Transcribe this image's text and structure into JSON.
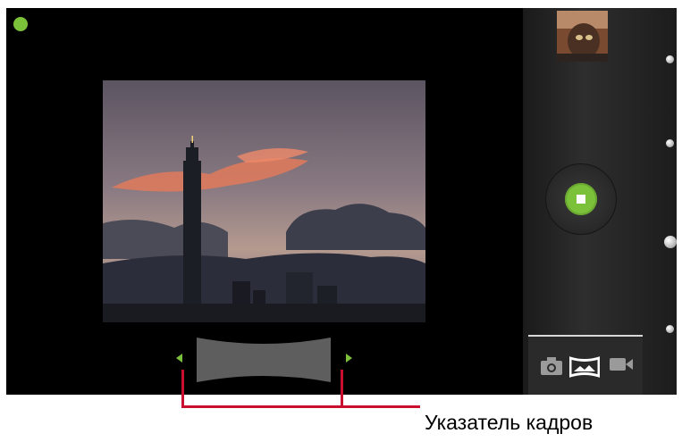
{
  "camera": {
    "status_color": "#7cc13a",
    "accent_color": "#7cc13a",
    "status_indicator": "recording-status-dot",
    "viewfinder_content": "city-skyline-at-dusk",
    "frame_indicator": {
      "left_arrow": "arrow-left-icon",
      "right_arrow": "arrow-right-icon"
    },
    "side_panel": {
      "thumbnail": "last-photo-thumbnail",
      "shutter_icon": "stop-icon",
      "modes": [
        {
          "name": "photo",
          "icon": "camera-icon",
          "active": false
        },
        {
          "name": "panorama",
          "icon": "panorama-icon",
          "active": true
        },
        {
          "name": "video",
          "icon": "video-camera-icon",
          "active": false
        }
      ]
    }
  },
  "callout": {
    "label": "Указатель кадров",
    "line_color": "#c8102e"
  }
}
